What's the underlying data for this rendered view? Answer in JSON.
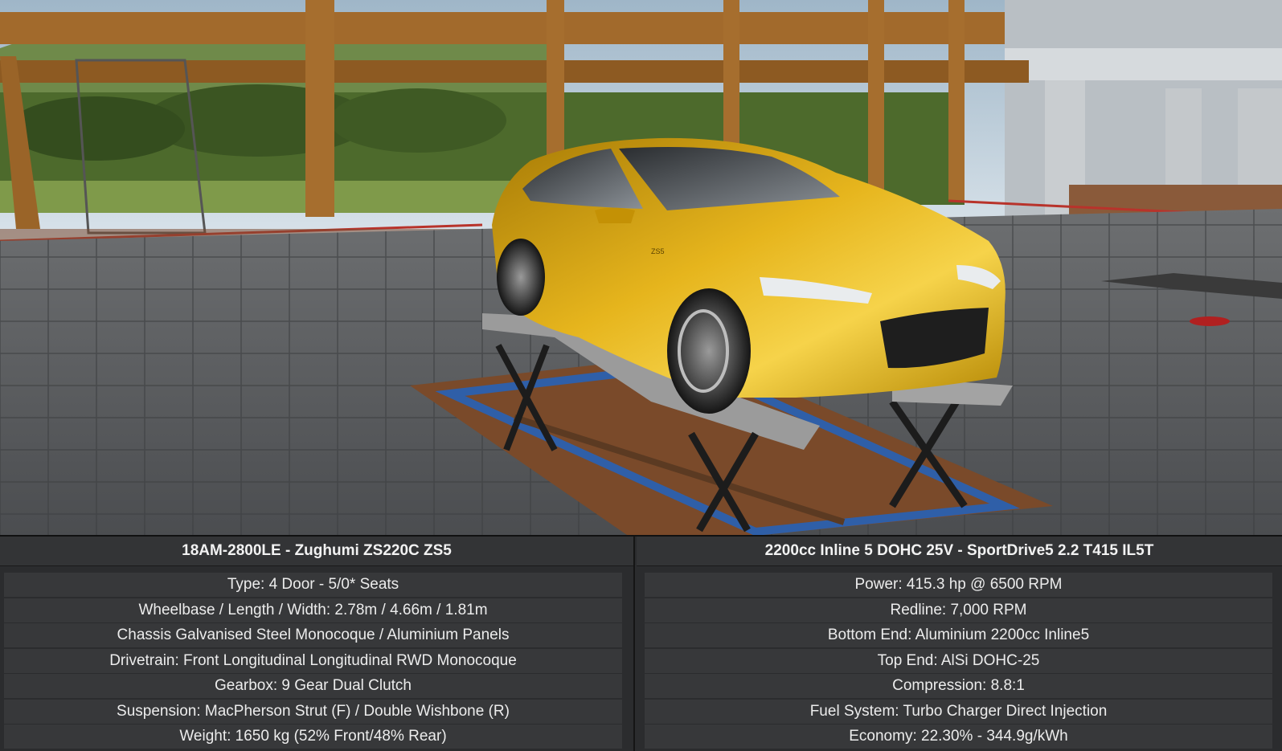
{
  "scene": {
    "car_color": "#d4a313",
    "floor_color": "#5a5c5e",
    "beam_color": "#a26a2c",
    "car_badge": "ZS5"
  },
  "car_panel": {
    "title": "18AM-2800LE - Zughumi ZS220C ZS5",
    "rows": [
      "Type: 4 Door - 5/0* Seats",
      "Wheelbase / Length / Width: 2.78m / 4.66m / 1.81m",
      "Chassis Galvanised Steel Monocoque / Aluminium Panels",
      "Drivetrain: Front Longitudinal Longitudinal RWD Monocoque",
      "Gearbox: 9 Gear Dual Clutch",
      "Suspension: MacPherson Strut (F) / Double Wishbone (R)",
      "Weight: 1650 kg (52% Front/48% Rear)"
    ]
  },
  "engine_panel": {
    "title": "2200cc Inline 5 DOHC 25V - SportDrive5 2.2 T415 IL5T",
    "rows": [
      "Power: 415.3 hp @ 6500 RPM",
      "Redline:  7,000 RPM",
      "Bottom End: Aluminium 2200cc Inline5",
      "Top End: AlSi DOHC-25",
      "Compression: 8.8:1",
      "Fuel System: Turbo Charger Direct Injection",
      "Economy: 22.30% - 344.9g/kWh"
    ]
  }
}
